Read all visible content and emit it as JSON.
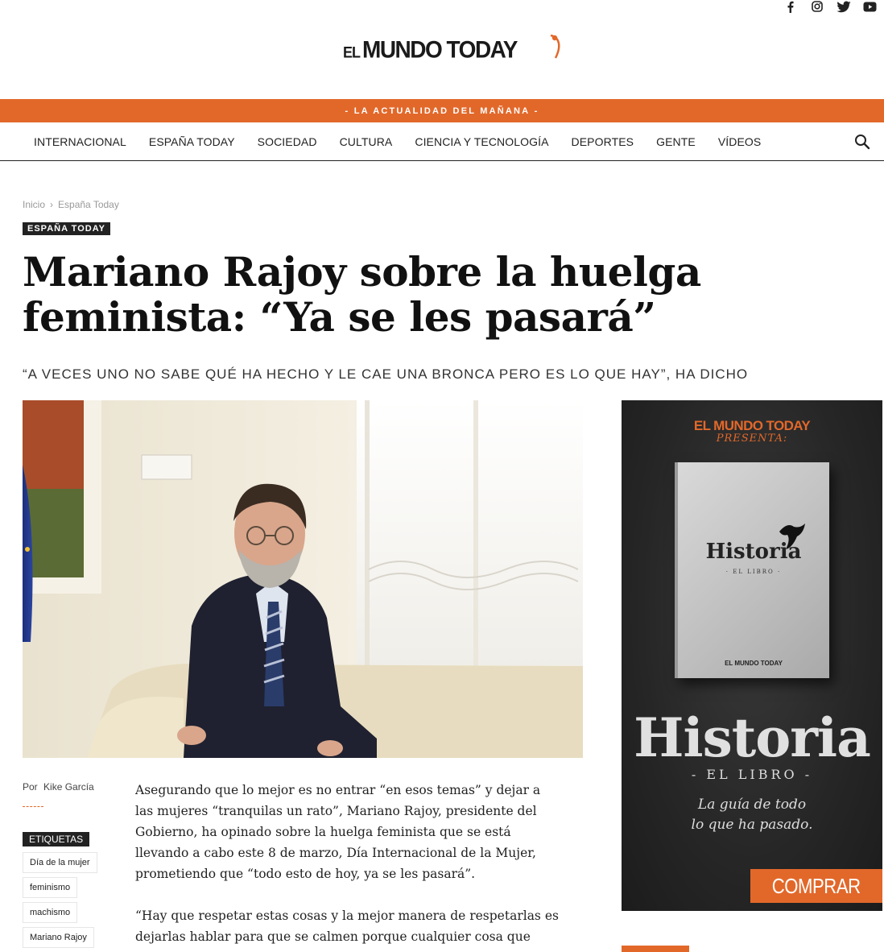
{
  "header": {
    "social": [
      "facebook-icon",
      "instagram-icon",
      "twitter-icon",
      "youtube-icon"
    ],
    "logo_prefix": "EL",
    "logo_main": "MUNDO TODAY",
    "tagline_dash_left": "-",
    "tagline_a": "LA ACTUALIDAD DEL ",
    "tagline_b": "MAÑANA",
    "tagline_dash_right": "-"
  },
  "nav": {
    "items": [
      "INTERNACIONAL",
      "ESPAÑA TODAY",
      "SOCIEDAD",
      "CULTURA",
      "CIENCIA Y TECNOLOGÍA",
      "DEPORTES",
      "GENTE",
      "VÍDEOS"
    ]
  },
  "breadcrumb": {
    "home": "Inicio",
    "sep": "›",
    "current": "España Today"
  },
  "article": {
    "category": "ESPAÑA TODAY",
    "title": "Mariano Rajoy sobre la huelga feminista: “Ya se les pasará”",
    "subtitle": "“A VECES UNO NO SABE QUÉ HA HECHO Y LE CAE UNA BRONCA PERO ES LO QUE HAY”, HA DICHO",
    "by_label": "Por",
    "author": "Kike García",
    "tags_label": "ETIQUETAS",
    "tags": [
      "Día de la mujer",
      "feminismo",
      "machismo",
      "Mariano Rajoy"
    ],
    "paragraphs": [
      "Asegurando que lo mejor es no entrar “en esos temas” y dejar a las mujeres “tranquilas un rato”, Mariano Rajoy, presidente del Gobierno, ha opinado sobre la huelga feminista que se está llevando a cabo este 8 de marzo, Día Internacional de la Mujer, prometiendo que “todo esto de hoy, ya se les pasará”.",
      "“Hay que respetar estas cosas y la mejor manera de respetarlas es dejarlas hablar para que se calmen porque cualquier cosa que digas"
    ]
  },
  "ad": {
    "brand": "EL MUNDO TODAY",
    "presenta": "PRESENTA:",
    "book_title": "Historia",
    "book_sub": "· EL LIBRO ·",
    "book_brand": "EL MUNDO TODAY",
    "big_title": "Historia",
    "big_sub": "- EL LIBRO -",
    "tagline_1": "La guía de todo",
    "tagline_2": "lo que ha pasado.",
    "buy": "COMPRAR"
  }
}
